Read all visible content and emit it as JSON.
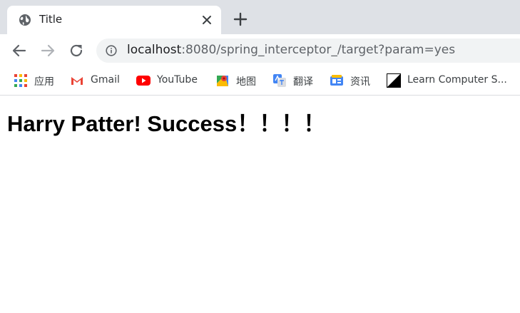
{
  "tab": {
    "title": "Title"
  },
  "address_bar": {
    "host": "localhost",
    "path": ":8080/spring_interceptor_/target?param=yes"
  },
  "bookmarks": [
    {
      "label": "应用"
    },
    {
      "label": "Gmail"
    },
    {
      "label": "YouTube"
    },
    {
      "label": "地图"
    },
    {
      "label": "翻译"
    },
    {
      "label": "资讯"
    },
    {
      "label": "Learn Computer S..."
    }
  ],
  "page": {
    "heading": "Harry Patter! Success！！！！"
  },
  "colors": {
    "tabstrip": "#dee1e6",
    "omnibox": "#f1f3f4",
    "youtube_red": "#ff0000",
    "gmail_red": "#ea4335"
  }
}
